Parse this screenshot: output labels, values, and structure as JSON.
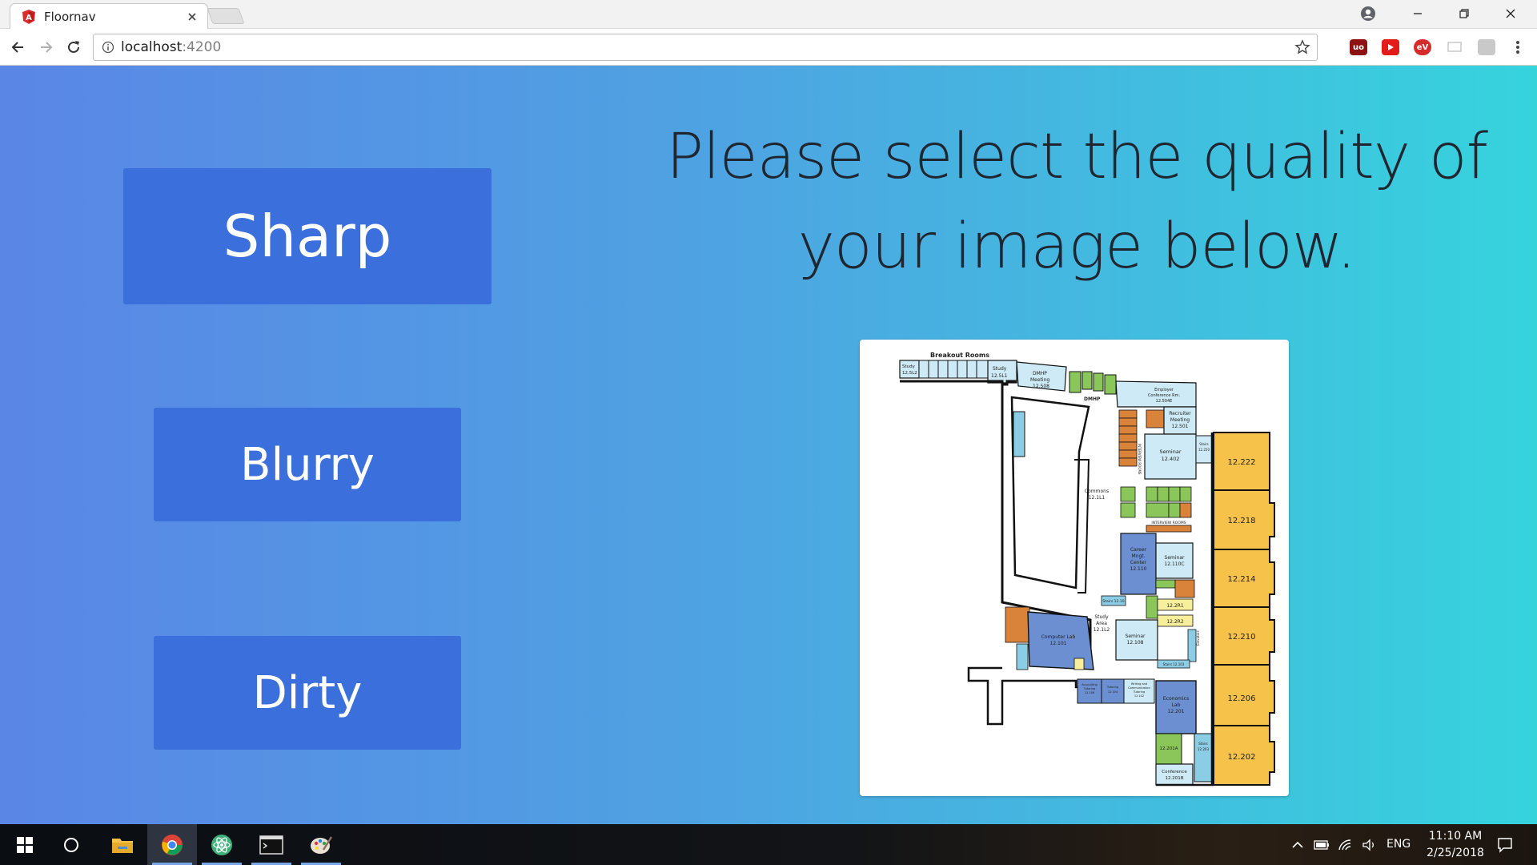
{
  "browser": {
    "tab_title": "Floornav",
    "url_host": "localhost",
    "url_port": ":4200"
  },
  "page": {
    "heading_line1": "Please select the quality of",
    "heading_line2": "your image below.",
    "buttons": {
      "sharp": "Sharp",
      "blurry": "Blurry",
      "dirty": "Dirty"
    }
  },
  "floorplan": {
    "title": "Breakout Rooms",
    "rooms": [
      {
        "label": "Study",
        "label2": "12.5L2"
      },
      {
        "label": "Study",
        "label2": "12.5L1"
      },
      {
        "label": "DMHP",
        "label2": "Meeting",
        "label3": "12.508"
      },
      {
        "label": "DMHP"
      },
      {
        "label": "Employer",
        "label2": "Conference Rm.",
        "label3": "12.504E"
      },
      {
        "label": "Recruiter",
        "label2": "Meeting",
        "label3": "12.501"
      },
      {
        "label": "INTERVIEW ROOMS"
      },
      {
        "label": "Seminar",
        "label2": "12.402"
      },
      {
        "label": "Stairs",
        "label2": "12.250"
      },
      {
        "label": "12.222"
      },
      {
        "label": "Commons",
        "label2": "12.1L1"
      },
      {
        "label": "INTERVIEW ROOMS"
      },
      {
        "label": "12.218"
      },
      {
        "label": "Career",
        "label2": "Mngt.",
        "label3": "Center",
        "label4": "12.110"
      },
      {
        "label": "Seminar",
        "label2": "12.110C"
      },
      {
        "label": "12.214"
      },
      {
        "label": "Stairs 12.10"
      },
      {
        "label": "12.2R1"
      },
      {
        "label": "12.2R2"
      },
      {
        "label": "Computer Lab",
        "label2": "12.101"
      },
      {
        "label": "Study",
        "label2": "Area",
        "label3": "12.1L2"
      },
      {
        "label": "Seminar",
        "label2": "12.108"
      },
      {
        "label": "Elevators"
      },
      {
        "label": "12.210"
      },
      {
        "label": "Stairs 12.103"
      },
      {
        "label": "Accounting",
        "label2": "Tutoring",
        "label3": "12.106"
      },
      {
        "label": "Tutoring",
        "label2": "12.104"
      },
      {
        "label": "Writing and",
        "label2": "Communication",
        "label3": "Tutoring",
        "label4": "12.102"
      },
      {
        "label": "Economics",
        "label2": "Lab",
        "label3": "12.201"
      },
      {
        "label": "12.206"
      },
      {
        "label": "12.201A"
      },
      {
        "label": "Stairs",
        "label2": "12.203"
      },
      {
        "label": "12.202"
      },
      {
        "label": "Conference",
        "label2": "12.201B"
      },
      {
        "label": "Stairs"
      }
    ]
  },
  "taskbar": {
    "language": "ENG",
    "time": "11:10 AM",
    "date": "2/25/2018"
  },
  "colors": {
    "button_bg": "#3a6fdc",
    "gradient_start": "#5a86e6",
    "gradient_end": "#36d3dd",
    "room_yellow": "#f6c24a",
    "room_blue": "#6b8fd1",
    "room_lightblue": "#cdeaf6",
    "room_green": "#8ac65a",
    "room_orange": "#d9833a"
  }
}
